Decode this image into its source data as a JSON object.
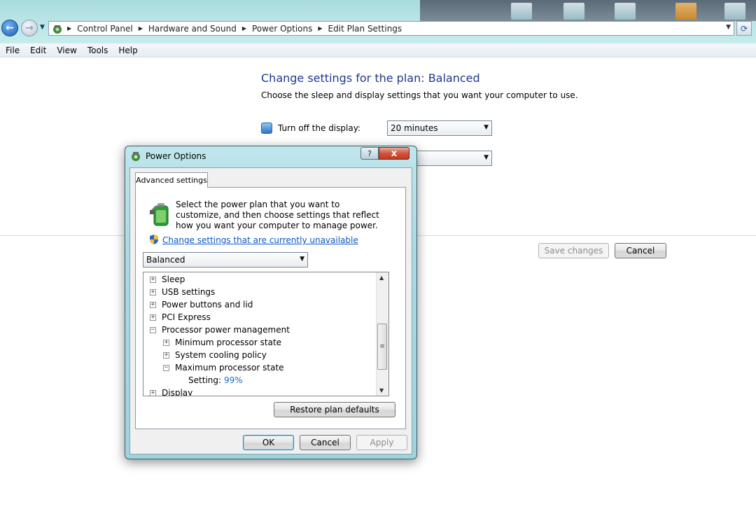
{
  "window": {
    "breadcrumbs": [
      "Control Panel",
      "Hardware and Sound",
      "Power Options",
      "Edit Plan Settings"
    ]
  },
  "menubar": {
    "items": [
      "File",
      "Edit",
      "View",
      "Tools",
      "Help"
    ]
  },
  "main": {
    "title": "Change settings for the plan: Balanced",
    "subtitle": "Choose the sleep and display settings that you want your computer to use.",
    "display_label": "Turn off the display:",
    "display_value": "20 minutes",
    "save_label": "Save changes",
    "cancel_label": "Cancel"
  },
  "dialog": {
    "title": "Power Options",
    "help_glyph": "?",
    "close_glyph": "x",
    "tab_label": "Advanced settings",
    "intro": "Select the power plan that you want to customize, and then choose settings that reflect how you want your computer to manage power.",
    "link": "Change settings that are currently unavailable",
    "plan_value": "Balanced",
    "tree": {
      "items": [
        {
          "label": "Sleep",
          "toggle": "+"
        },
        {
          "label": "USB settings",
          "toggle": "+"
        },
        {
          "label": "Power buttons and lid",
          "toggle": "+"
        },
        {
          "label": "PCI Express",
          "toggle": "+"
        },
        {
          "label": "Processor power management",
          "toggle": "−"
        },
        {
          "label": "Minimum processor state",
          "toggle": "+"
        },
        {
          "label": "System cooling policy",
          "toggle": "+"
        },
        {
          "label": "Maximum processor state",
          "toggle": "−"
        },
        {
          "label": "Display",
          "toggle": "+"
        }
      ],
      "setting_label": "Setting:",
      "setting_value": "99%"
    },
    "restore_label": "Restore plan defaults",
    "ok_label": "OK",
    "cancel_label": "Cancel",
    "apply_label": "Apply"
  },
  "colors": {
    "link": "#0b55c4",
    "title_blue": "#1e3a8a",
    "setting_value": "#1c6cc4",
    "close_red": "#c03b22"
  }
}
